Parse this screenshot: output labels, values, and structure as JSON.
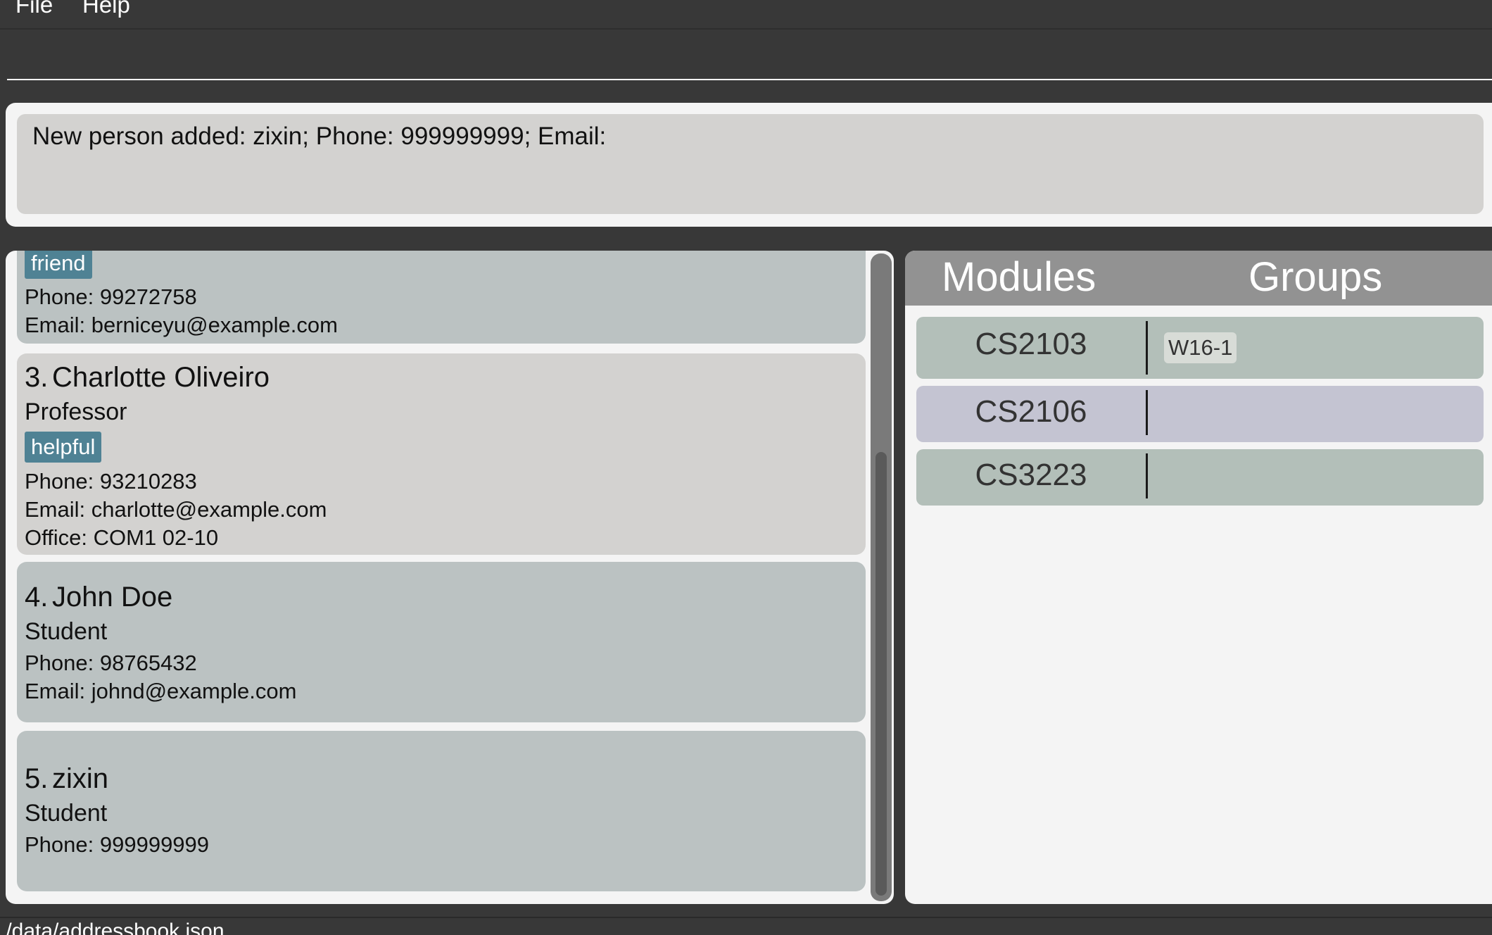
{
  "menu": {
    "file": "File",
    "help": "Help"
  },
  "command": {
    "value": "",
    "placeholder": ""
  },
  "result": {
    "text": "New person added: zixin; Phone: 999999999; Email:"
  },
  "persons": [
    {
      "tag": "friend",
      "phone": "Phone: 99272758",
      "email": "Email: berniceyu@example.com"
    },
    {
      "index": "3.",
      "name": "Charlotte Oliveiro",
      "role": "Professor",
      "tag": "helpful",
      "phone": "Phone: 93210283",
      "email": "Email: charlotte@example.com",
      "office": "Office: COM1 02-10"
    },
    {
      "index": "4.",
      "name": "John Doe",
      "role": "Student",
      "phone": "Phone: 98765432",
      "email": "Email: johnd@example.com"
    },
    {
      "index": "5.",
      "name": "zixin",
      "role": "Student",
      "phone": "Phone: 999999999"
    }
  ],
  "modules": {
    "header_modules": "Modules",
    "header_groups": "Groups",
    "rows": [
      {
        "code": "CS2103",
        "groups": [
          "W16-1"
        ],
        "color": "#b3bfb9"
      },
      {
        "code": "CS2106",
        "groups": [],
        "color": "#c4c4d2"
      },
      {
        "code": "CS3223",
        "groups": [],
        "color": "#b3bfb9"
      }
    ]
  },
  "status": {
    "path": "./data/addressbook.json"
  },
  "colors": {
    "card_default": "#bbc2c2",
    "card_selected": "#d3d2d0",
    "tag": "#4f8294",
    "background": "#383838"
  }
}
